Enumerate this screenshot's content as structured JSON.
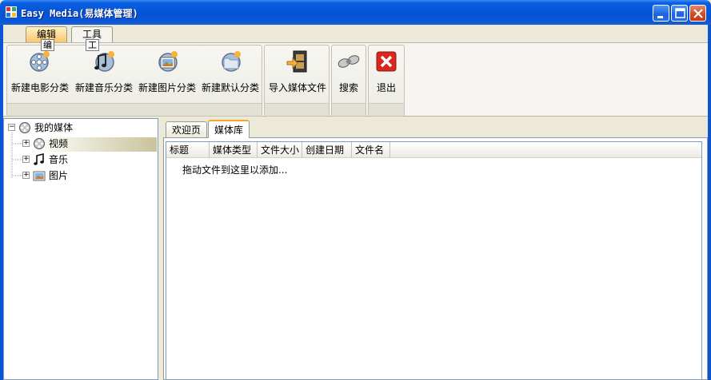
{
  "window": {
    "title": "Easy Media(易媒体管理)"
  },
  "ribbon_tabs": [
    {
      "label": "编辑",
      "keytip": "编",
      "active": true
    },
    {
      "label": "工具",
      "keytip": "工",
      "active": false
    }
  ],
  "ribbon_buttons": {
    "new_movie_category": "新建电影分类",
    "new_music_category": "新建音乐分类",
    "new_picture_category": "新建图片分类",
    "new_default_category": "新建默认分类",
    "import_media": "导入媒体文件",
    "search": "搜索",
    "exit": "退出"
  },
  "tree": {
    "root": "我的媒体",
    "children": [
      "视频",
      "音乐",
      "图片"
    ],
    "selected": "视频"
  },
  "doc_tabs": [
    {
      "label": "欢迎页",
      "active": false
    },
    {
      "label": "媒体库",
      "active": true
    }
  ],
  "list": {
    "columns": [
      "标题",
      "媒体类型",
      "文件大小",
      "创建日期",
      "文件名"
    ],
    "empty_hint": "拖动文件到这里以添加..."
  },
  "colors": {
    "titlebar": "#0453d6",
    "active_tab": "#f7c56a",
    "close_button": "#d1471f"
  }
}
